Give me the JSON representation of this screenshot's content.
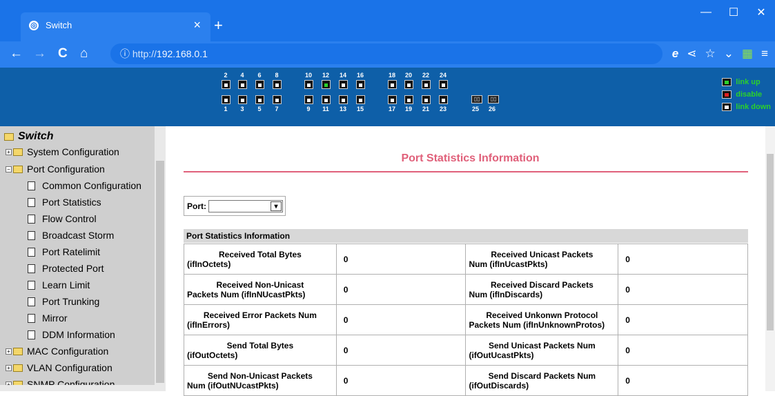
{
  "browser": {
    "tab_title": "Switch",
    "tab_close": "×",
    "new_tab": "+",
    "url_prefix": "http://",
    "url_host": "192.168.0.1",
    "win_min": "—",
    "win_max": "☐",
    "win_close": "✕",
    "back": "←",
    "forward": "→",
    "reload": "C",
    "home": "⌂"
  },
  "banner": {
    "top_labels": [
      "2",
      "4",
      "6",
      "8",
      "10",
      "12",
      "14",
      "16",
      "18",
      "20",
      "22",
      "24"
    ],
    "bottom_labels": [
      "1",
      "3",
      "5",
      "7",
      "9",
      "11",
      "13",
      "15",
      "17",
      "19",
      "21",
      "23",
      "25",
      "26"
    ],
    "port_up": "12",
    "legend": {
      "link_up": "link up",
      "disable": "disable",
      "link_down": "link down"
    }
  },
  "sidebar": {
    "root": "Switch",
    "items": [
      {
        "label": "System Configuration"
      },
      {
        "label": "Port Configuration"
      },
      {
        "label": "Common Configuration"
      },
      {
        "label": "Port Statistics"
      },
      {
        "label": "Flow Control"
      },
      {
        "label": "Broadcast Storm"
      },
      {
        "label": "Port Ratelimit"
      },
      {
        "label": "Protected Port"
      },
      {
        "label": "Learn Limit"
      },
      {
        "label": "Port Trunking"
      },
      {
        "label": "Mirror"
      },
      {
        "label": "DDM Information"
      },
      {
        "label": "MAC Configuration"
      },
      {
        "label": "VLAN Configuration"
      },
      {
        "label": "SNMP Configuration"
      }
    ]
  },
  "main": {
    "title": "Port Statistics Information",
    "port_label": "Port:",
    "port_value": "",
    "table_header": "Port Statistics Information",
    "rows": [
      {
        "l1a": "Received Total Bytes",
        "l1b": "(ifInOctets)",
        "v1": "0",
        "l2a": "Received Unicast Packets",
        "l2b": "Num (ifInUcastPkts)",
        "v2": "0"
      },
      {
        "l1a": "Received Non-Unicast",
        "l1b": "Packets Num (ifInNUcastPkts)",
        "v1": "0",
        "l2a": "Received Discard Packets",
        "l2b": "Num (ifInDiscards)",
        "v2": "0"
      },
      {
        "l1a": "Received Error Packets Num",
        "l1b": "(ifInErrors)",
        "v1": "0",
        "l2a": "Received Unkonwn Protocol",
        "l2b": "Packets Num (ifInUnknownProtos)",
        "v2": "0"
      },
      {
        "l1a": "Send Total Bytes",
        "l1b": "(ifOutOctets)",
        "v1": "0",
        "l2a": "Send Unicast Packets Num",
        "l2b": "(ifOutUcastPkts)",
        "v2": "0"
      },
      {
        "l1a": "Send Non-Unicast Packets",
        "l1b": "Num (ifOutNUcastPkts)",
        "v1": "0",
        "l2a": "Send Discard Packets Num",
        "l2b": "(ifOutDiscards)",
        "v2": "0"
      }
    ]
  }
}
